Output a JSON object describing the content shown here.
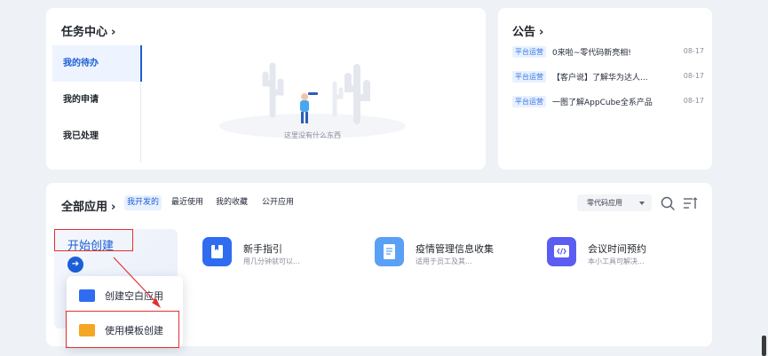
{
  "task_center": {
    "title": "任务中心",
    "tabs": [
      {
        "label": "我的待办",
        "active": true
      },
      {
        "label": "我的申请",
        "active": false
      },
      {
        "label": "我已处理",
        "active": false
      }
    ],
    "empty_text": "这里没有什么东西"
  },
  "announcement": {
    "title": "公告",
    "items": [
      {
        "tag": "平台运营",
        "text": "0来啦~零代码新亮相!",
        "date": "08-17"
      },
      {
        "tag": "平台运营",
        "text": "【客户说】了解华为达人...",
        "date": "08-17"
      },
      {
        "tag": "平台运营",
        "text": "一图了解AppCube全系产品",
        "date": "08-17"
      }
    ]
  },
  "apps": {
    "title": "全部应用",
    "tabs": [
      {
        "label": "我开发的",
        "active": true
      },
      {
        "label": "最近使用",
        "active": false
      },
      {
        "label": "我的收藏",
        "active": false
      },
      {
        "label": "公开应用",
        "active": false
      }
    ],
    "filter_value": "零代码应用",
    "start_create": "开始创建",
    "list": [
      {
        "name": "新手指引",
        "desc": "用几分钟就可以...",
        "icon": "book-icon",
        "color": "#2f6cf0"
      },
      {
        "name": "疫情管理信息收集",
        "desc": "适用于员工及其...",
        "icon": "document-icon",
        "color": "#5aa0f5"
      },
      {
        "name": "会议时间预约",
        "desc": "本小工具可解决...",
        "icon": "code-icon",
        "color": "#5b5cf2"
      }
    ]
  },
  "create_menu": {
    "items": [
      {
        "label": "创建空白应用",
        "icon": "blank-app-icon"
      },
      {
        "label": "使用模板创建",
        "icon": "template-icon"
      }
    ]
  },
  "colors": {
    "accent": "#1b5ed6",
    "highlight_red": "#e0312f"
  }
}
